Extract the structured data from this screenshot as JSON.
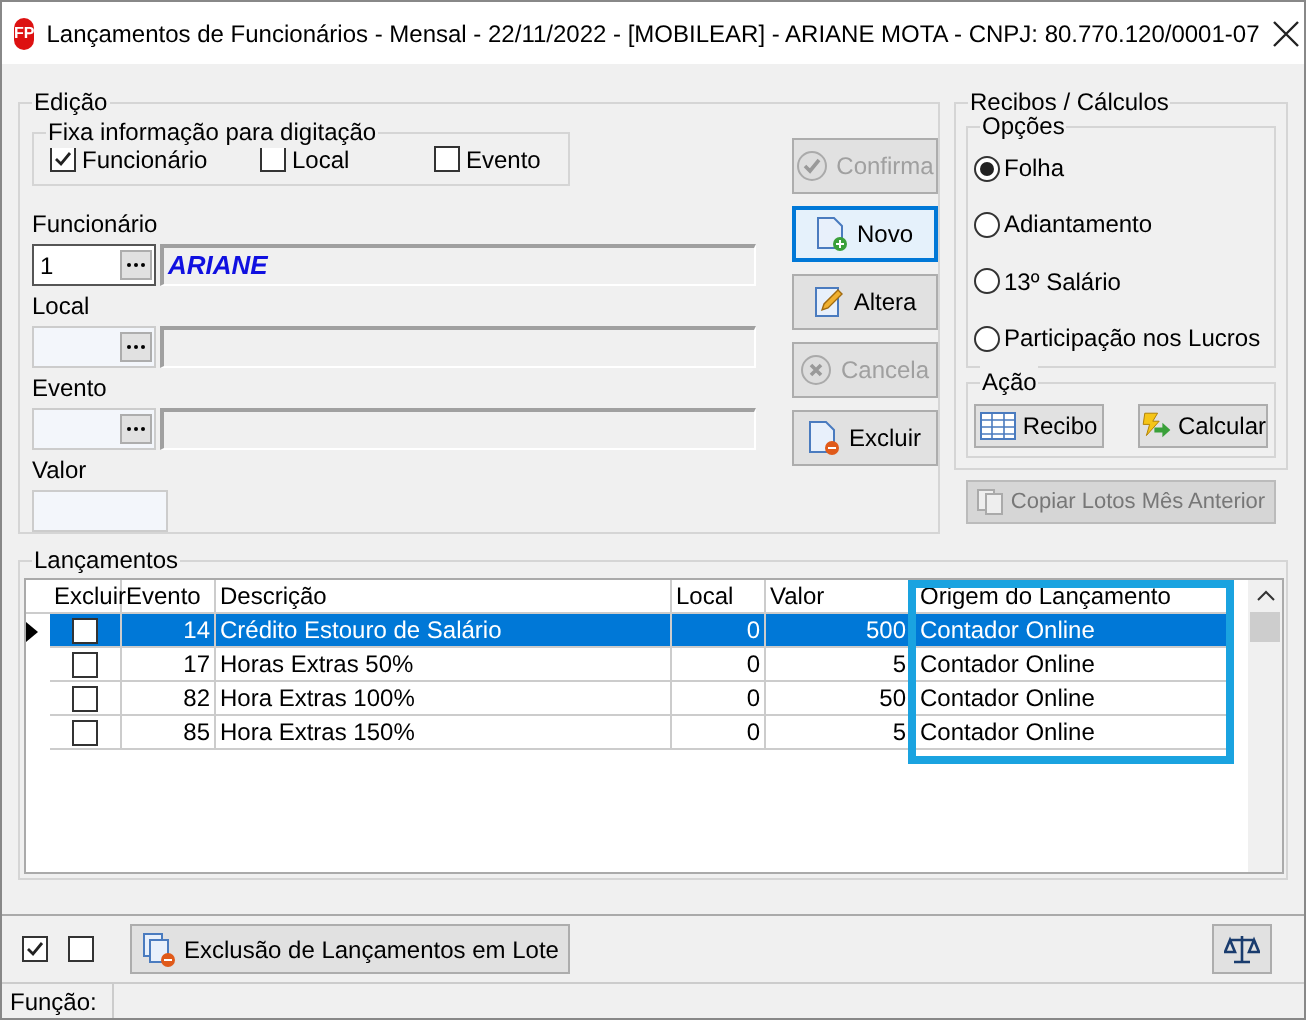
{
  "window": {
    "title": "Lançamentos de Funcionários - Mensal -  22/11/2022 - [MOBILEAR] - ARIANE MOTA - CNPJ: 80.770.120/0001-07",
    "logo": "FP"
  },
  "edicao": {
    "title": "Edição",
    "fixa": {
      "title": "Fixa informação para digitação",
      "options": [
        {
          "label": "Funcionário",
          "checked": true
        },
        {
          "label": "Local",
          "checked": false
        },
        {
          "label": "Evento",
          "checked": false
        }
      ]
    },
    "fields": [
      {
        "label": "Funcionário",
        "code": "1",
        "name": "ARIANE",
        "focused": true
      },
      {
        "label": "Local",
        "focused": false
      },
      {
        "label": "Evento",
        "focused": false
      }
    ],
    "valor": {
      "label": "Valor"
    },
    "buttons": [
      {
        "label": "Confirma",
        "disabled": true,
        "focused": false
      },
      {
        "label": "Novo",
        "disabled": false,
        "focused": true
      },
      {
        "label": "Altera",
        "disabled": false,
        "focused": false
      },
      {
        "label": "Cancela",
        "disabled": true,
        "focused": false
      },
      {
        "label": "Excluir",
        "disabled": false,
        "focused": false
      }
    ]
  },
  "recibos": {
    "title": "Recibos / Cálculos",
    "opcoes_title": "Opções",
    "options": [
      {
        "label": "Folha",
        "selected": true
      },
      {
        "label": "Adiantamento",
        "selected": false
      },
      {
        "label": "13º Salário",
        "selected": false
      },
      {
        "label": "Participação nos Lucros",
        "selected": false
      }
    ],
    "acao_title": "Ação",
    "acao_buttons": [
      {
        "label": "Recibo"
      },
      {
        "label": "Calcular"
      }
    ],
    "copy_button": {
      "label": "Copiar Lotos Mês Anterior",
      "disabled": true
    }
  },
  "lancamentos": {
    "title": "Lançamentos",
    "columns": [
      "Excluir",
      "Evento",
      "Descrição",
      "Local",
      "Valor",
      "Origem do Lançamento"
    ],
    "rows": [
      {
        "excluir": false,
        "evento": "14",
        "descricao": "Crédito Estouro de Salário",
        "local": "0",
        "valor": "500",
        "origem": "Contador Online",
        "selected": true
      },
      {
        "excluir": false,
        "evento": "17",
        "descricao": "Horas Extras 50%",
        "local": "0",
        "valor": "5",
        "origem": "Contador Online",
        "selected": false
      },
      {
        "excluir": false,
        "evento": "82",
        "descricao": "Hora Extras 100%",
        "local": "0",
        "valor": "50",
        "origem": "Contador Online",
        "selected": false
      },
      {
        "excluir": false,
        "evento": "85",
        "descricao": "Hora Extras 150%",
        "local": "0",
        "valor": "5",
        "origem": "Contador Online",
        "selected": false
      }
    ]
  },
  "toolbar": {
    "checks": [
      {
        "checked": true
      },
      {
        "checked": false
      }
    ],
    "lote_button": "Exclusão de Lançamentos em Lote"
  },
  "status_bar": {
    "label": "Função:"
  }
}
